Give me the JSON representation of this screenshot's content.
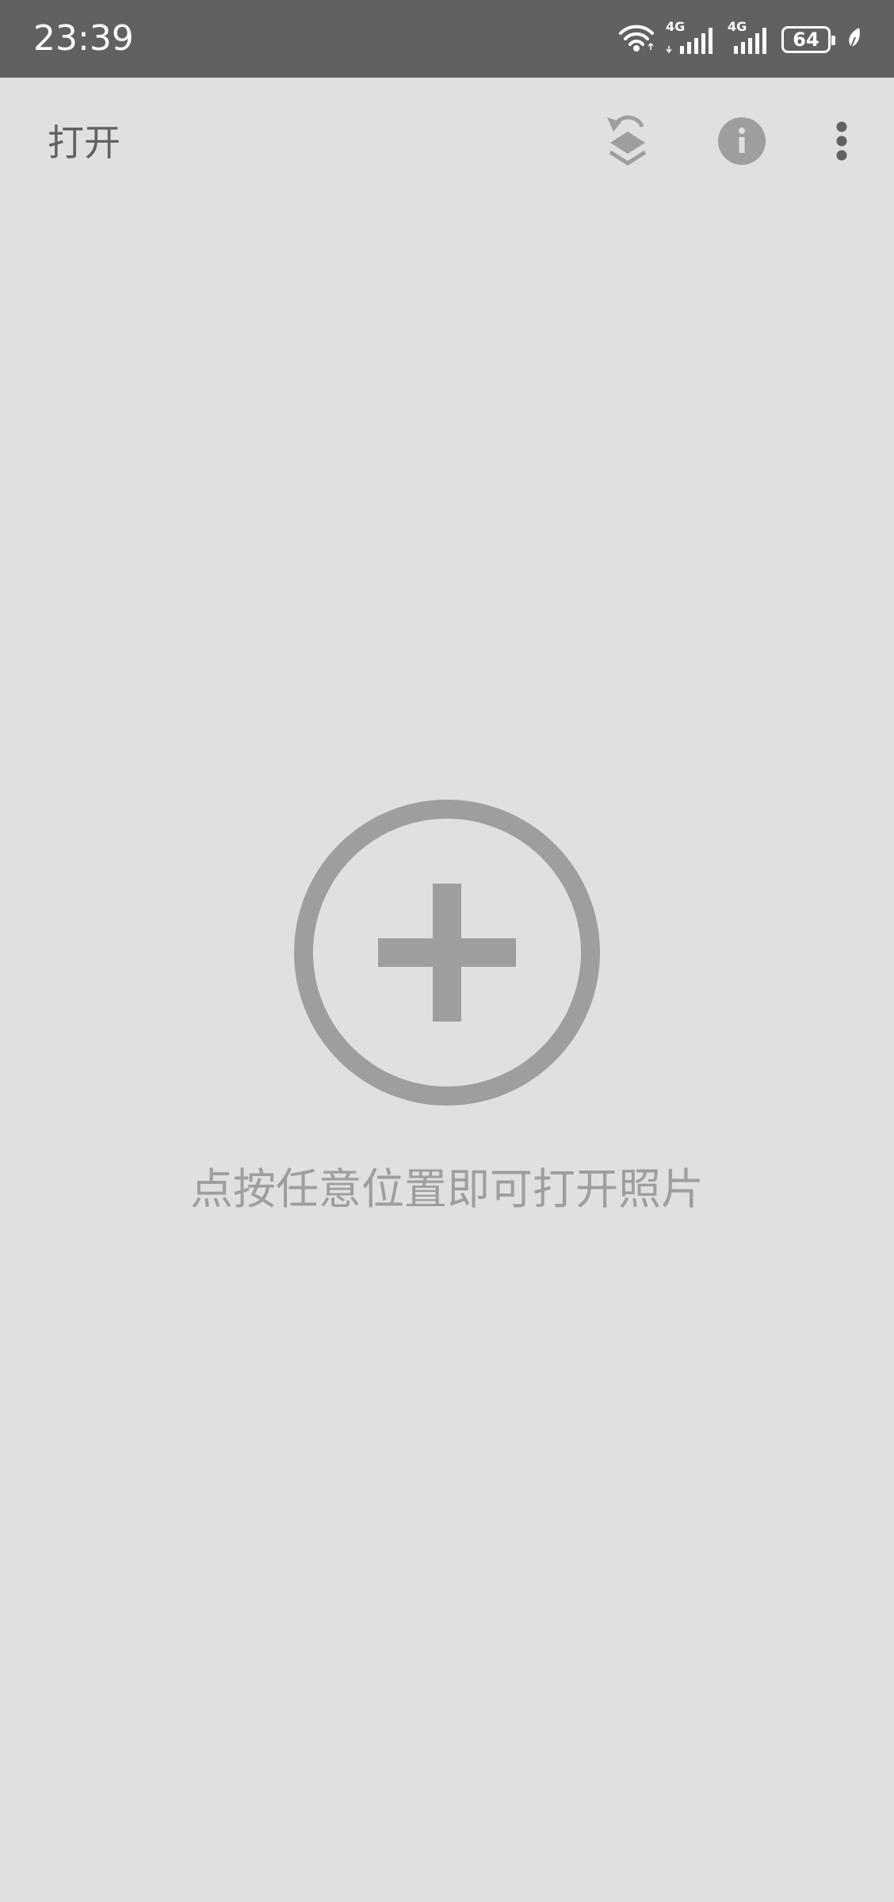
{
  "status_bar": {
    "time": "23:39",
    "network_1": "4G",
    "network_2": "4G",
    "battery_level": "64",
    "icons": [
      "wifi-icon",
      "signal-icon",
      "signal-icon",
      "battery-icon",
      "leaf-icon"
    ]
  },
  "app_bar": {
    "title": "打开",
    "actions": [
      "layers-undo-icon",
      "info-icon",
      "more-vert-icon"
    ]
  },
  "main": {
    "hint": "点按任意位置即可打开照片",
    "center_icon": "add-circle-icon"
  },
  "colors": {
    "status_bar_bg": "#616161",
    "background": "#e0e0e0",
    "icon_gray": "#9e9e9e",
    "title_gray": "#616161"
  }
}
